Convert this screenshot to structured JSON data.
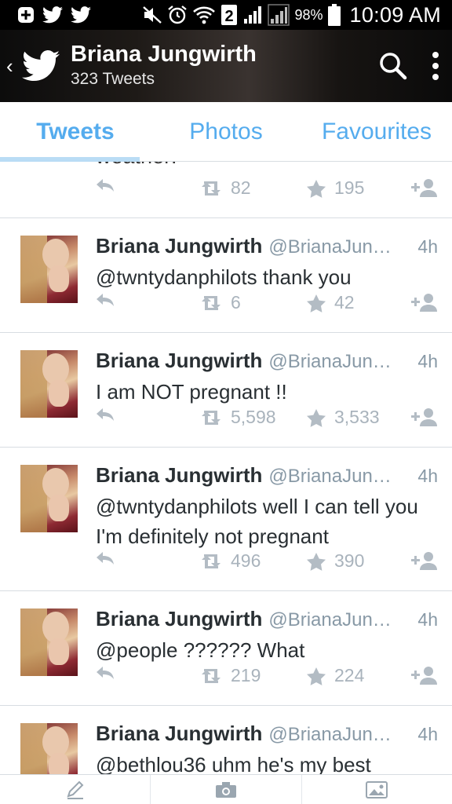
{
  "status_bar": {
    "icons": [
      "plus-icon",
      "twitter-icon",
      "twitter-icon",
      "mute-icon",
      "alarm-icon",
      "wifi-icon",
      "sim-2-icon",
      "signal-icon",
      "signal-icon"
    ],
    "sim_label": "2",
    "battery": "98%",
    "time": "10:09 AM"
  },
  "header": {
    "name": "Briana Jungwirth",
    "subtitle": "323 Tweets"
  },
  "tabs": [
    {
      "label": "Tweets",
      "active": true
    },
    {
      "label": "Photos",
      "active": false
    },
    {
      "label": "Favourites",
      "active": false
    }
  ],
  "partial_tweet": {
    "text": "weather!",
    "retweets": "82",
    "favorites": "195"
  },
  "tweets": [
    {
      "name": "Briana Jungwirth",
      "handle": "@BrianaJung...",
      "time": "4h",
      "text": "@twntydanphilots thank you",
      "retweets": "6",
      "favorites": "42"
    },
    {
      "name": "Briana Jungwirth",
      "handle": "@BrianaJung...",
      "time": "4h",
      "text": "I am NOT pregnant !!",
      "retweets": "5,598",
      "favorites": "3,533"
    },
    {
      "name": "Briana Jungwirth",
      "handle": "@BrianaJung...",
      "time": "4h",
      "text": "@twntydanphilots well I can tell you I'm definitely not pregnant",
      "retweets": "496",
      "favorites": "390"
    },
    {
      "name": "Briana Jungwirth",
      "handle": "@BrianaJung...",
      "time": "4h",
      "text": "@people ?????? What",
      "retweets": "219",
      "favorites": "224"
    },
    {
      "name": "Briana Jungwirth",
      "handle": "@BrianaJung...",
      "time": "4h",
      "text": "@bethlou36 uhm he's my best",
      "retweets": "",
      "favorites": ""
    }
  ],
  "bottom_bar": [
    "compose-icon",
    "camera-icon",
    "image-icon"
  ],
  "colors": {
    "accent": "#55acee",
    "muted": "#8899a6",
    "text": "#292f33",
    "action": "#b3bcc4"
  }
}
